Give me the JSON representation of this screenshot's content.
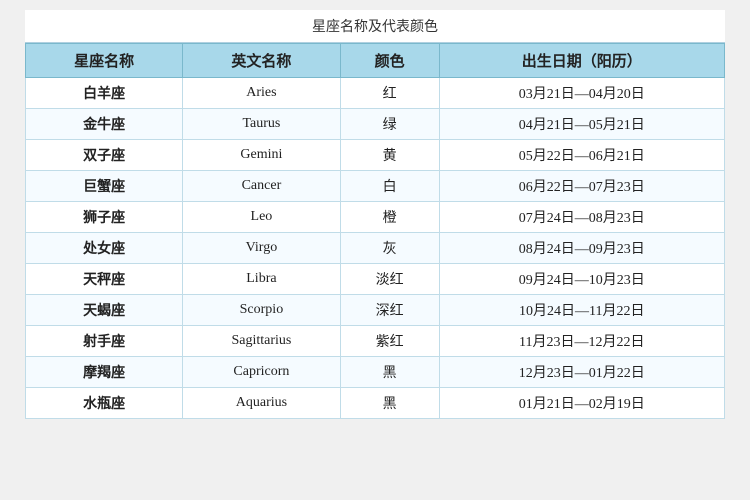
{
  "title": "星座名称及代表颜色",
  "headers": [
    "星座名称",
    "英文名称",
    "颜色",
    "出生日期（阳历）"
  ],
  "rows": [
    {
      "chinese": "白羊座",
      "english": "Aries",
      "color": "红",
      "date": "03月21日—04月20日"
    },
    {
      "chinese": "金牛座",
      "english": "Taurus",
      "color": "绿",
      "date": "04月21日—05月21日"
    },
    {
      "chinese": "双子座",
      "english": "Gemini",
      "color": "黄",
      "date": "05月22日—06月21日"
    },
    {
      "chinese": "巨蟹座",
      "english": "Cancer",
      "color": "白",
      "date": "06月22日—07月23日"
    },
    {
      "chinese": "狮子座",
      "english": "Leo",
      "color": "橙",
      "date": "07月24日—08月23日"
    },
    {
      "chinese": "处女座",
      "english": "Virgo",
      "color": "灰",
      "date": "08月24日—09月23日"
    },
    {
      "chinese": "天秤座",
      "english": "Libra",
      "color": "淡红",
      "date": "09月24日—10月23日"
    },
    {
      "chinese": "天蝎座",
      "english": "Scorpio",
      "color": "深红",
      "date": "10月24日—11月22日"
    },
    {
      "chinese": "射手座",
      "english": "Sagittarius",
      "color": "紫红",
      "date": "11月23日—12月22日"
    },
    {
      "chinese": "摩羯座",
      "english": "Capricorn",
      "color": "黑",
      "date": "12月23日—01月22日"
    },
    {
      "chinese": "水瓶座",
      "english": "Aquarius",
      "color": "黑",
      "date": "01月21日—02月19日"
    }
  ]
}
